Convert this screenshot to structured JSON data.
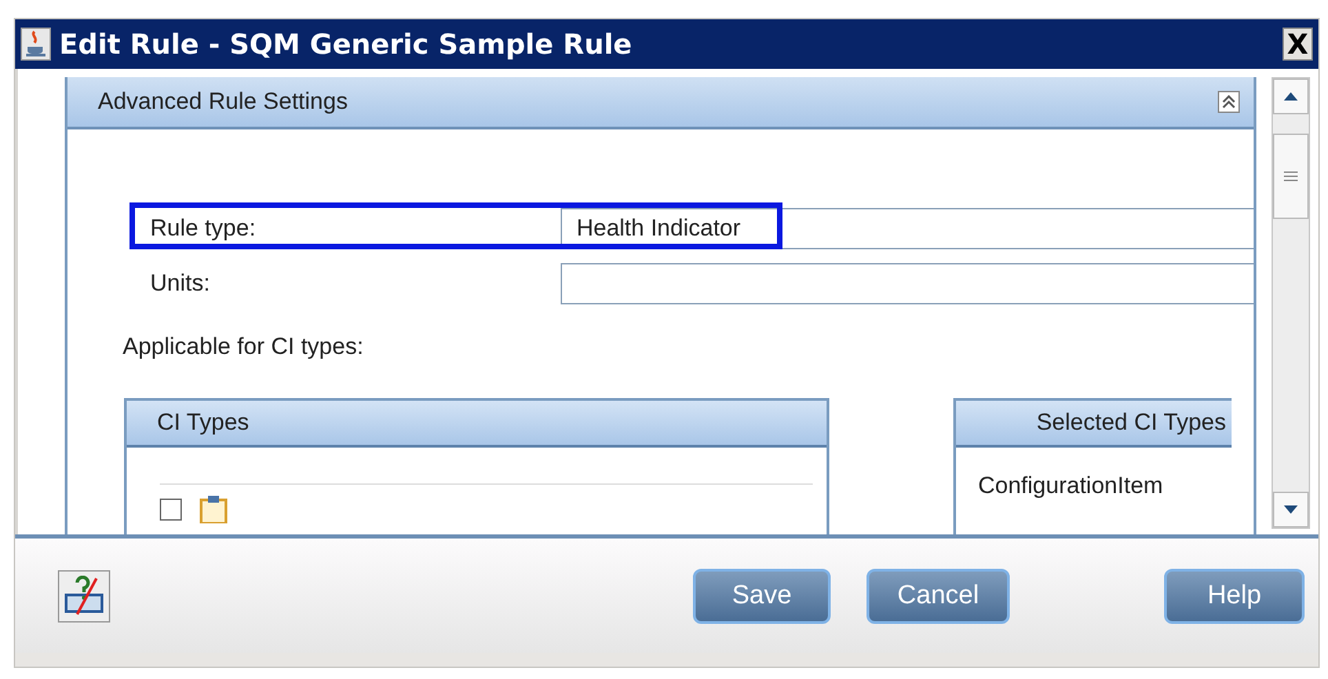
{
  "window": {
    "title": "Edit Rule - SQM Generic Sample Rule",
    "close": "X"
  },
  "section": {
    "title": "Advanced Rule Settings",
    "expanded": true
  },
  "fields": [
    {
      "label": "Rule type:",
      "value": "Health Indicator",
      "highlighted": true
    },
    {
      "label": "Units:",
      "highlighted": false
    }
  ],
  "applicable_label": "Applicable for CI types:",
  "ci_types": {
    "title": "CI Types",
    "rows": [
      {
        "checked": false
      }
    ]
  },
  "selected_ci_types": {
    "title": "Selected CI Types",
    "items": [
      "ConfigurationItem"
    ]
  },
  "buttons": [
    "Save",
    "Cancel",
    "Help"
  ]
}
